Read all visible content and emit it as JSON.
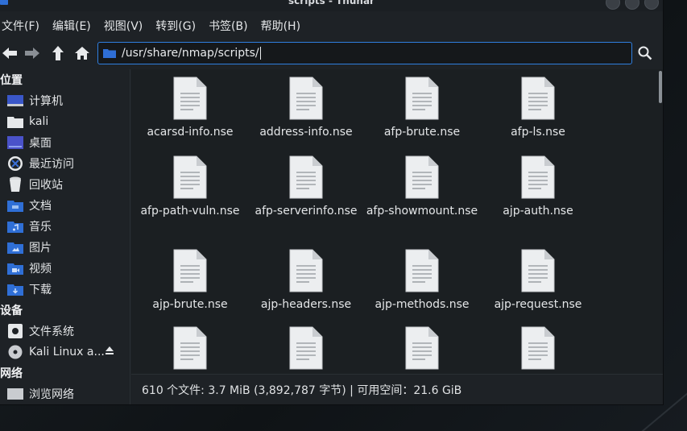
{
  "window": {
    "title": "scripts - Thunar"
  },
  "menu": [
    "文件(F)",
    "编辑(E)",
    "视图(V)",
    "转到(G)",
    "书签(B)",
    "帮助(H)"
  ],
  "address": {
    "path": "/usr/share/nmap/scripts/"
  },
  "sidebar": {
    "places_title": "位置",
    "places": [
      {
        "label": "计算机",
        "icon": "computer-icon"
      },
      {
        "label": "kali",
        "icon": "home-folder-icon"
      },
      {
        "label": "桌面",
        "icon": "desktop-icon"
      },
      {
        "label": "最近访问",
        "icon": "recent-icon"
      },
      {
        "label": "回收站",
        "icon": "trash-icon"
      },
      {
        "label": "文档",
        "icon": "documents-folder-icon"
      },
      {
        "label": "音乐",
        "icon": "music-folder-icon"
      },
      {
        "label": "图片",
        "icon": "pictures-folder-icon"
      },
      {
        "label": "视频",
        "icon": "videos-folder-icon"
      },
      {
        "label": "下载",
        "icon": "downloads-folder-icon"
      }
    ],
    "devices_title": "设备",
    "devices": [
      {
        "label": "文件系统",
        "icon": "filesystem-icon"
      },
      {
        "label": "Kali Linux a...",
        "icon": "disc-icon"
      }
    ],
    "network_title": "网络",
    "network": [
      {
        "label": "浏览网络",
        "icon": "network-icon"
      }
    ]
  },
  "files": [
    "acarsd-info.nse",
    "address-info.nse",
    "afp-brute.nse",
    "afp-ls.nse",
    "afp-path-vuln.nse",
    "afp-serverinfo.nse",
    "afp-showmount.nse",
    "ajp-auth.nse",
    "ajp-brute.nse",
    "ajp-headers.nse",
    "ajp-methods.nse",
    "ajp-request.nse",
    "",
    "",
    "",
    ""
  ],
  "status": {
    "text": "610 个文件: 3.7 MiB (3,892,787 字节) | 可用空间：21.6 GiB"
  },
  "colors": {
    "accent": "#2f7fe0",
    "folder": "#2f6fd6",
    "window_bg": "#1e2226"
  }
}
